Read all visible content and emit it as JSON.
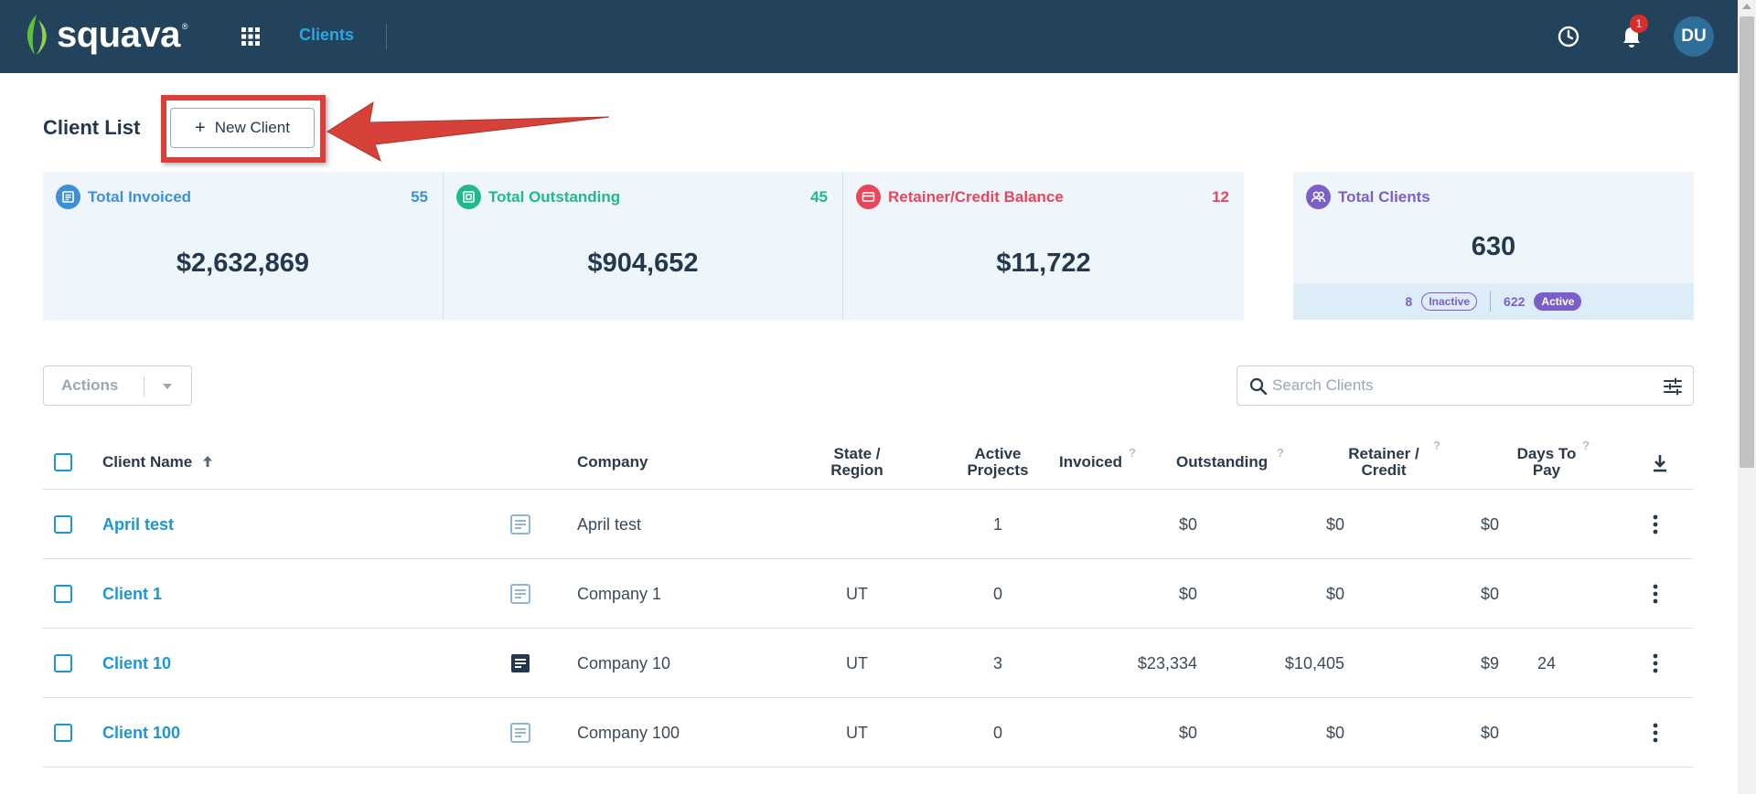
{
  "app": {
    "brand": "squava",
    "brand_reg": "®",
    "nav_clients": "Clients",
    "notification_count": "1",
    "avatar_initials": "DU"
  },
  "header": {
    "title": "Client List",
    "new_client_label": "New Client",
    "new_client_plus": "+"
  },
  "stats": [
    {
      "label": "Total Invoiced",
      "count": "55",
      "amount": "$2,632,869",
      "color": "#3f8fd8",
      "icon": "invoice-icon"
    },
    {
      "label": "Total Outstanding",
      "count": "45",
      "amount": "$904,652",
      "color": "#1fb98a",
      "icon": "outstanding-icon"
    },
    {
      "label": "Retainer/Credit Balance",
      "count": "12",
      "amount": "$11,722",
      "color": "#e8475b",
      "icon": "credit-card-icon"
    }
  ],
  "total_clients": {
    "label": "Total Clients",
    "count": "630",
    "inactive_count": "8",
    "inactive_label": "Inactive",
    "active_count": "622",
    "active_label": "Active",
    "color": "#7b5fc9",
    "icon": "people-icon"
  },
  "toolbar": {
    "actions_label": "Actions",
    "search_placeholder": "Search Clients"
  },
  "table": {
    "columns": {
      "client_name": "Client Name",
      "company": "Company",
      "state_1": "State /",
      "state_2": "Region",
      "active_1": "Active",
      "active_2": "Projects",
      "invoiced": "Invoiced",
      "outstanding": "Outstanding",
      "retainer_1": "Retainer /",
      "retainer_2": "Credit",
      "days_1": "Days To",
      "days_2": "Pay",
      "help": "?"
    },
    "rows": [
      {
        "name": "April test",
        "company": "April test",
        "state": "",
        "active": "1",
        "invoiced": "$0",
        "outstanding": "$0",
        "retainer": "$0",
        "days": "",
        "has_notes": false
      },
      {
        "name": "Client 1",
        "company": "Company 1",
        "state": "UT",
        "active": "0",
        "invoiced": "$0",
        "outstanding": "$0",
        "retainer": "$0",
        "days": "",
        "has_notes": false
      },
      {
        "name": "Client 10",
        "company": "Company 10",
        "state": "UT",
        "active": "3",
        "invoiced": "$23,334",
        "outstanding": "$10,405",
        "retainer": "$9",
        "days": "24",
        "has_notes": true
      },
      {
        "name": "Client 100",
        "company": "Company 100",
        "state": "UT",
        "active": "0",
        "invoiced": "$0",
        "outstanding": "$0",
        "retainer": "$0",
        "days": "",
        "has_notes": false
      }
    ]
  }
}
